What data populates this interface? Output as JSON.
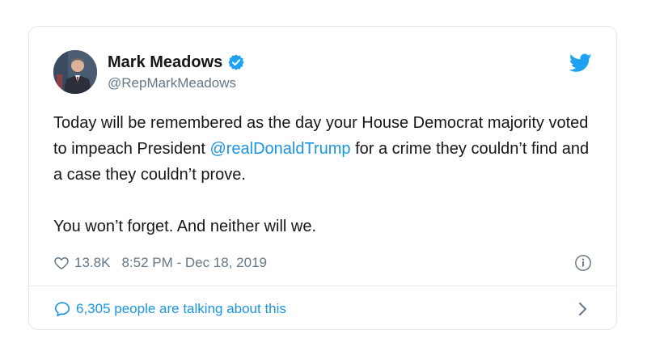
{
  "tweet": {
    "author": {
      "name": "Mark Meadows",
      "handle": "@RepMarkMeadows",
      "verified": true
    },
    "text_before_mention": "Today will be remembered as the day your House Democrat majority voted to impeach President ",
    "mention": "@realDonaldTrump",
    "text_after_mention": " for a crime they couldn’t find and a case they couldn’t prove.",
    "second_paragraph": "You won’t forget. And neither will we.",
    "likes": "13.8K",
    "timestamp": "8:52 PM - Dec 18, 2019"
  },
  "footer": {
    "talking_label": "6,305 people are talking about this"
  },
  "colors": {
    "link": "#1b95e0",
    "muted": "#657786",
    "border": "#e1e8ed",
    "twitter_blue": "#1da1f2"
  },
  "icons": [
    "twitter-bird-icon",
    "verified-badge-icon",
    "heart-icon",
    "info-icon",
    "comment-bubble-icon",
    "chevron-right-icon"
  ]
}
